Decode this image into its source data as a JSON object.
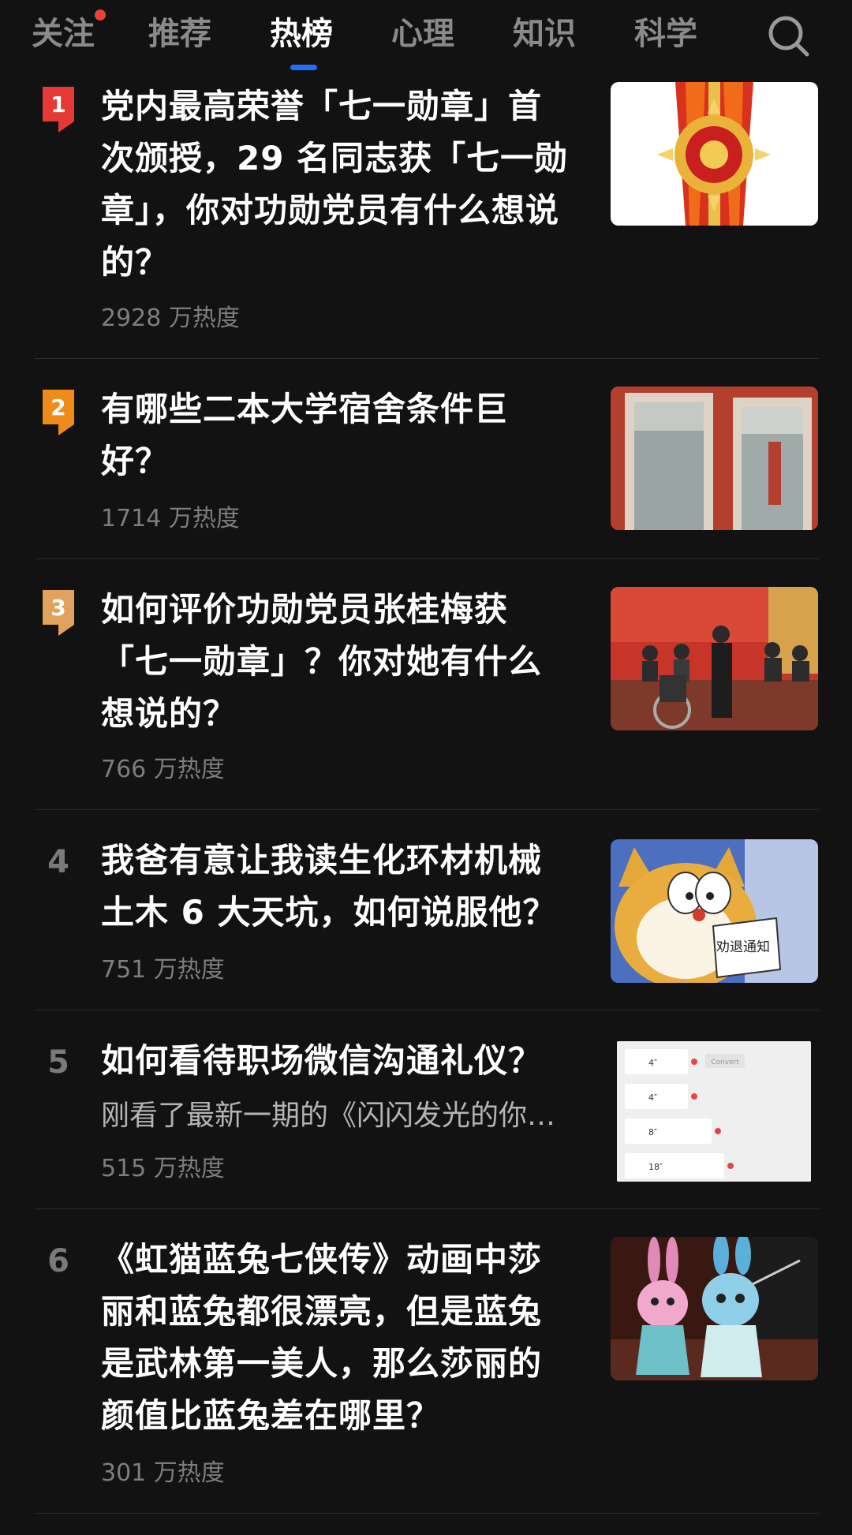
{
  "tabs": [
    {
      "label": "关注",
      "has_dot": true
    },
    {
      "label": "推荐"
    },
    {
      "label": "热榜",
      "active": true
    },
    {
      "label": "心理"
    },
    {
      "label": "知识"
    },
    {
      "label": "科学"
    }
  ],
  "search_icon": "search-icon",
  "colors": {
    "background": "#121212",
    "accent": "#1e6fff",
    "notify_dot": "#f1403c",
    "rank1": "#e53935",
    "rank2": "#f08a19",
    "rank3": "#e0a25e"
  },
  "hot_list": [
    {
      "rank": "1",
      "title": "党内最高荣誉「七一勋章」首次颁授，29 名同志获「七一勋章」，你对功勋党员有什么想说的？",
      "heat": "2928 万热度",
      "thumbnail": "medal-image"
    },
    {
      "rank": "2",
      "title": "有哪些二本大学宿舍条件巨好？",
      "heat": "1714 万热度",
      "thumbnail": "dorm-doors-image"
    },
    {
      "rank": "3",
      "title": "如何评价功勋党员张桂梅获「七一勋章」？你对她有什么想说的？",
      "heat": "766 万热度",
      "thumbnail": "ceremony-image"
    },
    {
      "rank": "4",
      "title": "我爸有意让我读生化环材机械土木 6 大天坑，如何说服他？",
      "heat": "751 万热度",
      "thumbnail": "cartoon-cat-image",
      "thumbnail_text": "劝退通知"
    },
    {
      "rank": "5",
      "title": "如何看待职场微信沟通礼仪？",
      "excerpt": "刚看了最新一期的《闪闪发光的你…",
      "heat": "515 万热度",
      "thumbnail": "voice-messages-image",
      "thumbnail_messages": [
        "4″",
        "4″",
        "8″",
        "18″"
      ],
      "thumbnail_convert": "Convert"
    },
    {
      "rank": "6",
      "title": "《虹猫蓝兔七侠传》动画中莎丽和蓝兔都很漂亮，但是蓝兔是武林第一美人，那么莎丽的颜值比蓝兔差在哪里？",
      "heat": "301 万热度",
      "thumbnail": "cartoon-rabbits-image"
    }
  ]
}
